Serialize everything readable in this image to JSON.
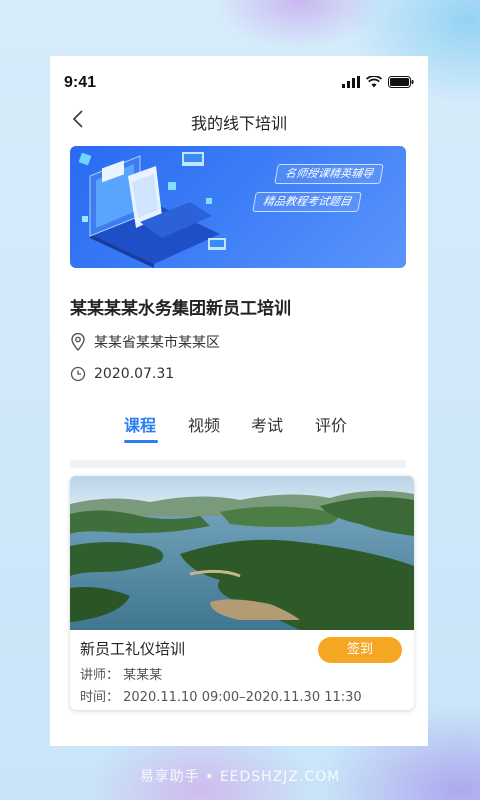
{
  "status_bar": {
    "time": "9:41"
  },
  "nav": {
    "title": "我的线下培训"
  },
  "banner": {
    "tag1": "名师授课精英辅导",
    "tag2": "精品教程考试题目"
  },
  "course": {
    "title": "某某某某水务集团新员工培训",
    "location": "某某省某某市某某区",
    "date": "2020.07.31"
  },
  "tabs": [
    {
      "label": "课程",
      "active": true
    },
    {
      "label": "视频",
      "active": false
    },
    {
      "label": "考试",
      "active": false
    },
    {
      "label": "评价",
      "active": false
    }
  ],
  "session": {
    "title": "新员工礼仪培训",
    "signin_label": "签到",
    "lecturer": "讲师：  某某某",
    "time": "时间：  2020.11.10 09:00–2020.11.30 11:30"
  },
  "watermark": "易享助手 • EEDSHZJZ.COM",
  "colors": {
    "accent": "#2a7ef3",
    "signin": "#f5a623"
  }
}
